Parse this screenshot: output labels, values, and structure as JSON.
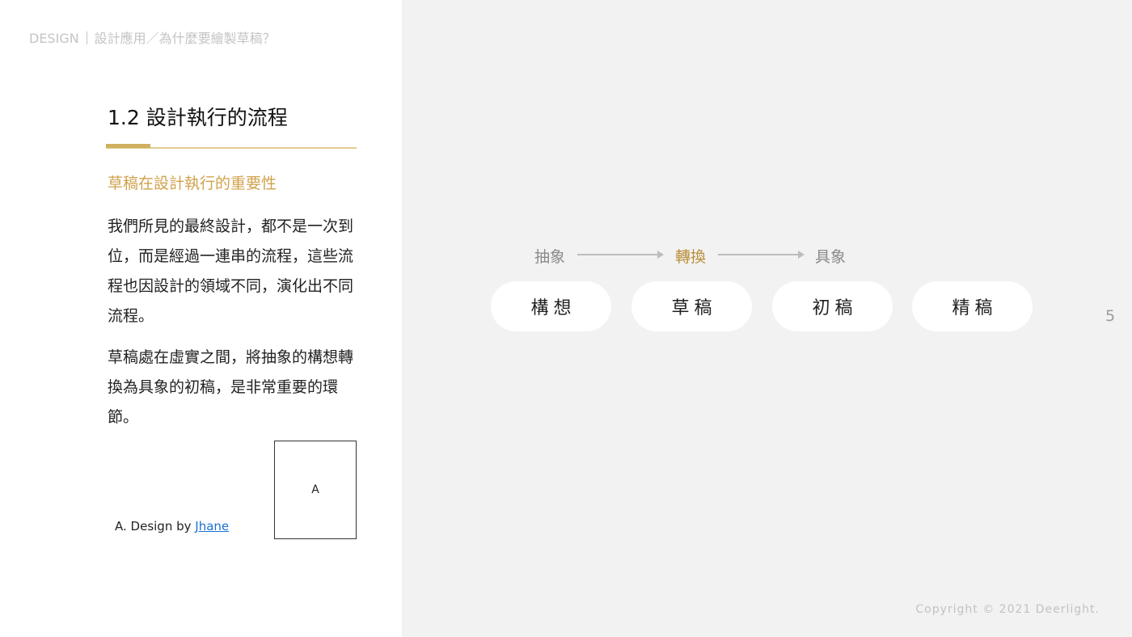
{
  "breadcrumb": {
    "section": "DESIGN",
    "path": "設計應用／為什麼要繪製草稿？"
  },
  "page_title": "1.2 設計執行的流程",
  "subtitle": "草稿在設計執行的重要性",
  "paragraphs": [
    "我們所見的最終設計，都不是一次到位，而是經過一連串的流程，這些流程也因設計的領域不同，演化出不同流程。",
    "草稿處在虛實之間，將抽象的構想轉換為具象的初稿，是非常重要的環節。"
  ],
  "figure": {
    "credit_prefix": "A. Design by",
    "credit_link": "Jhane",
    "thumb_label": "A"
  },
  "flow": {
    "labels": [
      "抽象",
      "轉換",
      "具象"
    ],
    "steps": [
      "構想",
      "草稿",
      "初稿",
      "精稿"
    ]
  },
  "page_number": "5",
  "copyright": "Copyright © 2021 Deerlight.",
  "colors": {
    "accent": "#d1a24c",
    "active_label": "#b98d39",
    "right_panel_bg": "#f2f2f2"
  }
}
